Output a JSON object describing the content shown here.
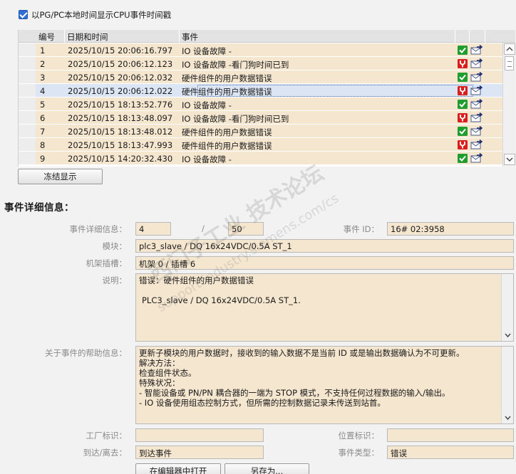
{
  "options": {
    "cpu_time_label": "以PG/PC本地时间显示CPU事件时间戳",
    "cpu_time_checked": true
  },
  "table": {
    "headers": {
      "no": "编号",
      "datetime": "日期和时间",
      "event": "事件"
    },
    "rows": [
      {
        "no": "1",
        "datetime": "2025/10/15 20:06:16.797",
        "event": "IO 设备故障 -",
        "status": "ok"
      },
      {
        "no": "2",
        "datetime": "2025/10/15 20:06:12.123",
        "event": "IO 设备故障 -看门狗时间已到",
        "status": "error"
      },
      {
        "no": "3",
        "datetime": "2025/10/15 20:06:12.032",
        "event": "硬件组件的用户数据错误",
        "status": "ok"
      },
      {
        "no": "4",
        "datetime": "2025/10/15 20:06:12.022",
        "event": "硬件组件的用户数据错误",
        "status": "error"
      },
      {
        "no": "5",
        "datetime": "2025/10/15 18:13:52.776",
        "event": "IO 设备故障 -",
        "status": "ok"
      },
      {
        "no": "6",
        "datetime": "2025/10/15 18:13:48.097",
        "event": "IO 设备故障 -看门狗时间已到",
        "status": "error"
      },
      {
        "no": "7",
        "datetime": "2025/10/15 18:13:48.012",
        "event": "硬件组件的用户数据错误",
        "status": "ok"
      },
      {
        "no": "8",
        "datetime": "2025/10/15 18:13:47.993",
        "event": "硬件组件的用户数据错误",
        "status": "error"
      },
      {
        "no": "9",
        "datetime": "2025/10/15 14:20:32.430",
        "event": "IO 设备故障 -",
        "status": "ok"
      }
    ],
    "selected_row": "4"
  },
  "freeze_button": "冻结显示",
  "details": {
    "title": "事件详细信息：",
    "detail_label": "事件详细信息：",
    "detail_index": "4",
    "slash": "/",
    "detail_total": "50",
    "event_id_label": "事件 ID：",
    "event_id": "16# 02:3958",
    "module_label": "模块：",
    "module": "plc3_slave / DQ 16x24VDC/0.5A ST_1",
    "rack_label": "机架插槽：",
    "rack": "机架 0 / 插槽 6",
    "desc_label": "说明：",
    "desc_lines": [
      "错误：硬件组件的用户数据错误",
      "",
      "PLC3_slave / DQ 16x24VDC/0.5A ST_1."
    ],
    "help_label": "关于事件的帮助信息：",
    "help_lines": [
      "更新子模块的用户数据时，接收到的输入数据不是当前 ID 或是输出数据确认为不可更新。",
      "解决方法：",
      "检查组件状态。",
      "特殊状况：",
      "- 智能设备或 PN/PN 耦合器的一端为 STOP 模式，不支持任何过程数据的输入/输出。",
      "- IO 设备使用组态控制方式，但所需的控制数据记录未传送到站首。"
    ],
    "plant_label": "工厂标识：",
    "plant": "",
    "location_label": "位置标识：",
    "location": "",
    "to_label": "到达/离去：",
    "to_value": "到达事件",
    "type_label": "事件类型：",
    "type_value": "错误"
  },
  "buttons": {
    "open_editor": "在编辑器中打开",
    "save_as": "另存为..."
  },
  "watermark": {
    "main": "西门子工业 技术论坛",
    "url": "support.industry.siemens.com/cs"
  }
}
